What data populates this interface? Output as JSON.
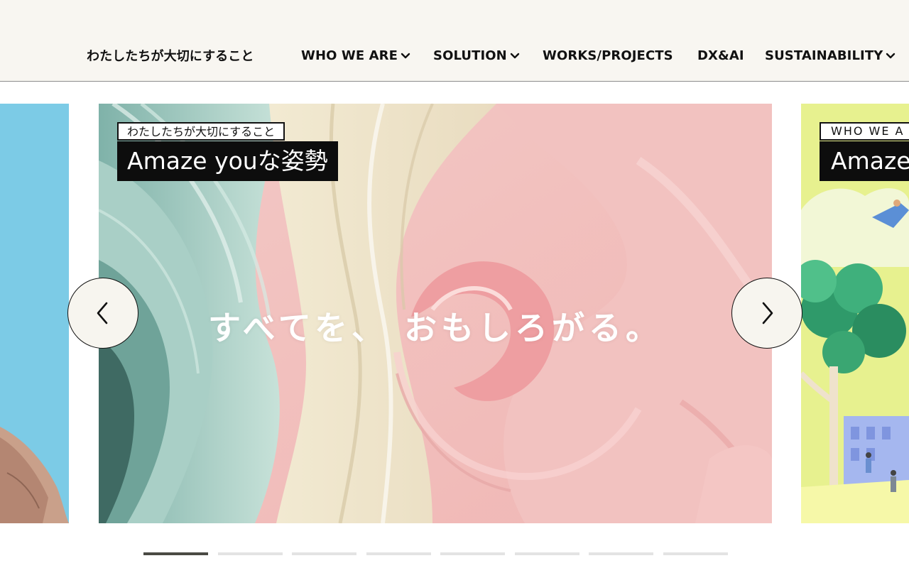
{
  "nav": {
    "items": [
      {
        "label": "わたしたちが大切にすること",
        "has_dropdown": false
      },
      {
        "label": "WHO WE ARE",
        "has_dropdown": true
      },
      {
        "label": "SOLUTION",
        "has_dropdown": true
      },
      {
        "label": "WORKS/PROJECTS",
        "has_dropdown": false
      },
      {
        "label": "DX&AI",
        "has_dropdown": false
      },
      {
        "label": "SUSTAINABILITY",
        "has_dropdown": true
      }
    ]
  },
  "carousel": {
    "main": {
      "category": "わたしたちが大切にすること",
      "title": "Amaze youな姿勢",
      "tagline": "すべてを、 おもしろがる。"
    },
    "next": {
      "category": "WHO WE A",
      "title": "Amaze"
    },
    "prev_icon": "chevron-left-icon",
    "next_icon": "chevron-right-icon",
    "pagination": {
      "count": 8,
      "active_index": 0
    }
  },
  "colors": {
    "header_bg": "#f8f6f1",
    "left_slide": "#7ccbe6",
    "right_slide": "#e7f18f",
    "pager_active": "#4a4a44",
    "pager_inactive": "#e3e3e3"
  }
}
